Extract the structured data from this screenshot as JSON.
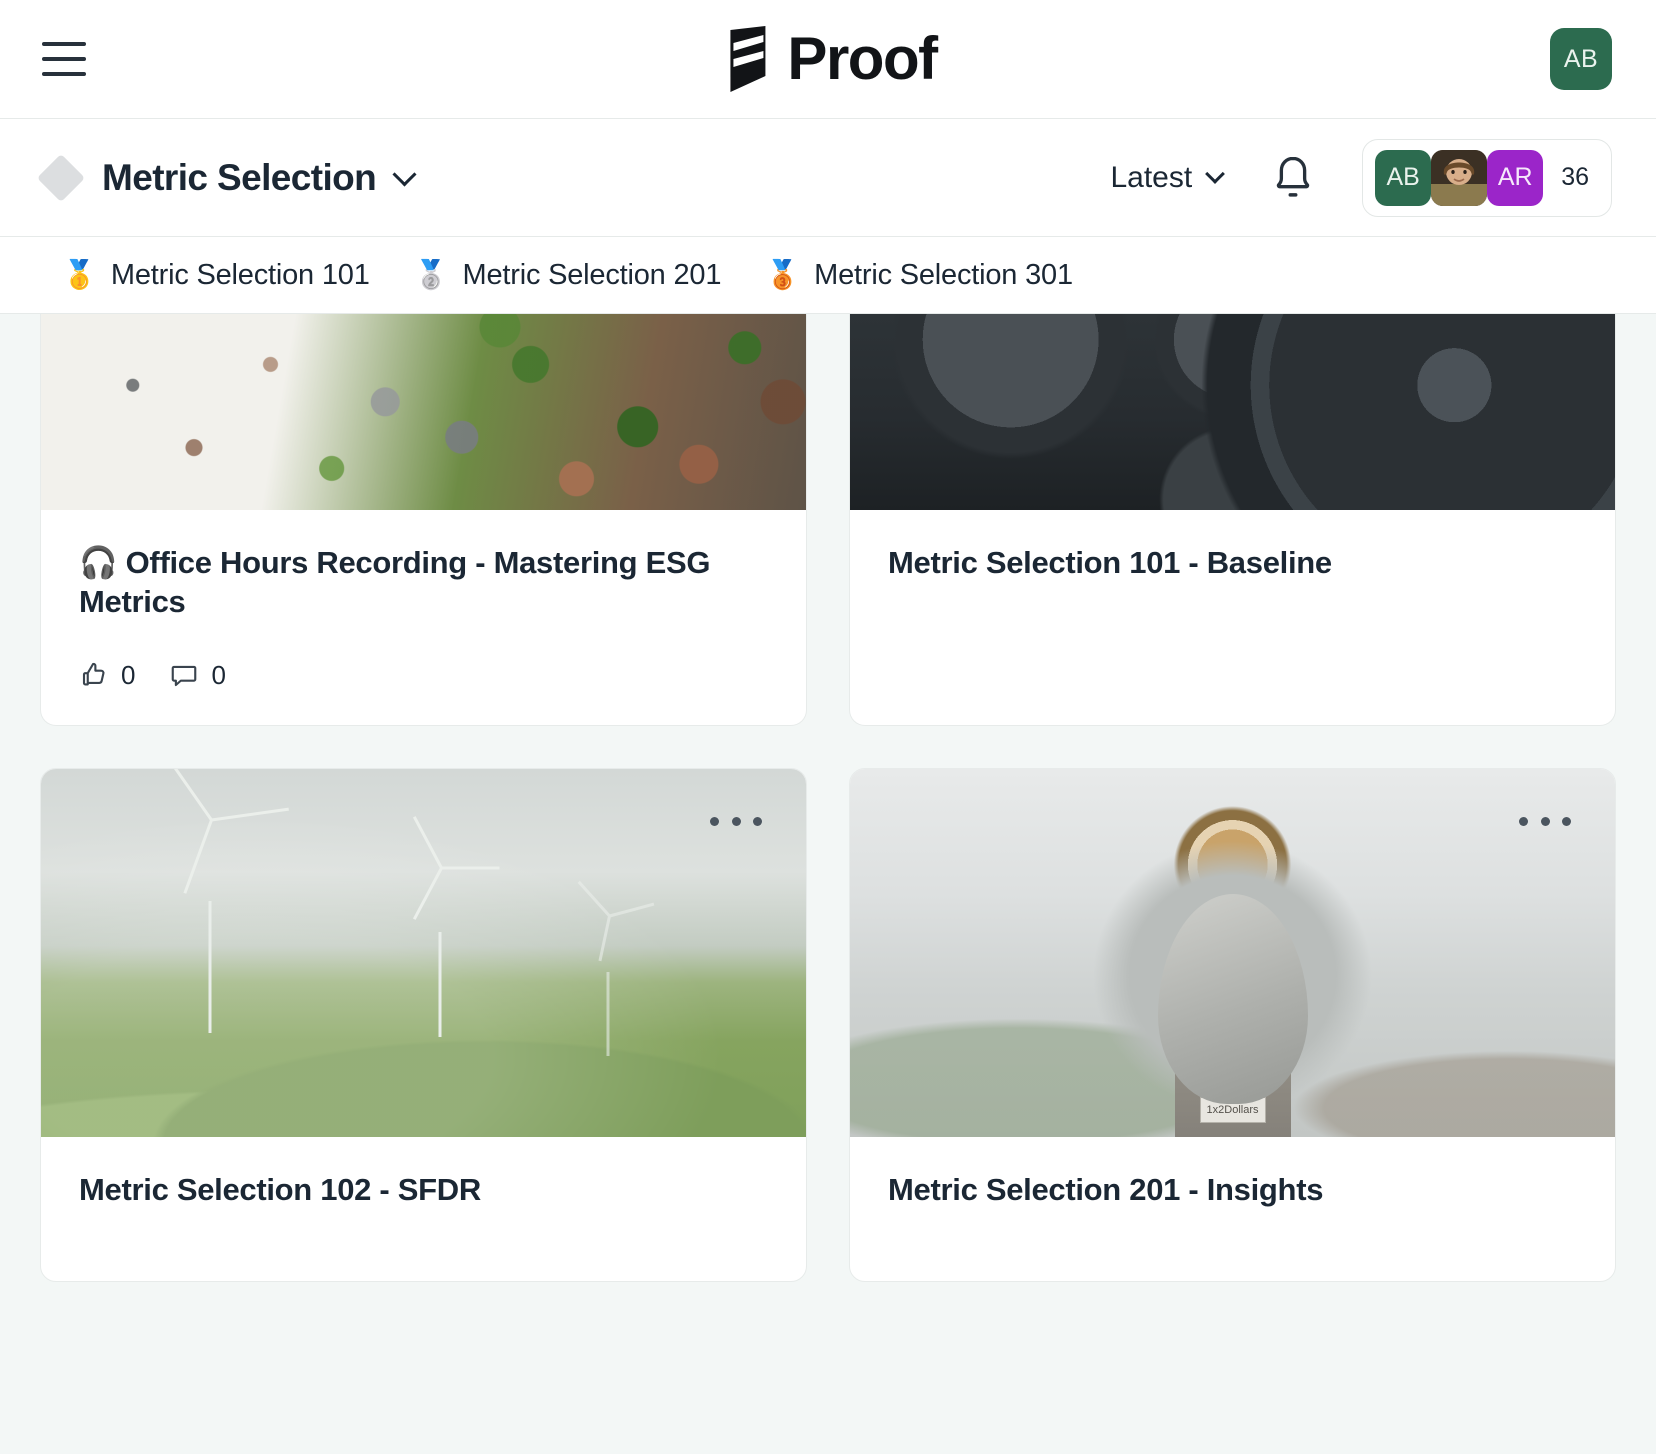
{
  "topbar": {
    "menu_icon": "hamburger-icon",
    "brand_name": "Proof",
    "brand_mark_icon": "proof-logo-mark",
    "user_initials": "AB",
    "user_avatar_color": "#2C6B4F"
  },
  "subheader": {
    "space_icon": "diamond-icon",
    "title": "Metric Selection",
    "title_chevron_icon": "chevron-down-icon",
    "sort": {
      "label": "Latest",
      "chevron_icon": "chevron-down-icon"
    },
    "notifications_icon": "bell-icon",
    "members": {
      "avatars": [
        {
          "type": "initials",
          "initials": "AB",
          "color": "#2C6B4F"
        },
        {
          "type": "photo",
          "initials": "",
          "color": "#6B5A44"
        },
        {
          "type": "initials",
          "initials": "AR",
          "color": "#9B25C9"
        }
      ],
      "count": "36"
    }
  },
  "tabs": [
    {
      "emoji": "🥇",
      "label": "Metric Selection 101",
      "icon": "gold-medal-icon"
    },
    {
      "emoji": "🥈",
      "label": "Metric Selection 201",
      "icon": "silver-medal-icon"
    },
    {
      "emoji": "🥉",
      "label": "Metric Selection 301",
      "icon": "bronze-medal-icon"
    }
  ],
  "cards": [
    {
      "title": "🎧 Office Hours Recording - Mastering ESG Metrics",
      "image": "rocks-and-moss-photo",
      "has_more_menu": false,
      "likes": "0",
      "comments": "0",
      "like_icon": "thumbs-up-icon",
      "comment_icon": "comment-icon"
    },
    {
      "title": "Metric Selection 101 - Baseline",
      "image": "engine-gauges-photo",
      "has_more_menu": false,
      "likes": "",
      "comments": "",
      "like_icon": "thumbs-up-icon",
      "comment_icon": "comment-icon"
    },
    {
      "title": "Metric Selection 102 - SFDR",
      "image": "wind-turbines-photo",
      "has_more_menu": true,
      "more_icon": "more-horizontal-icon",
      "likes": "",
      "comments": "",
      "like_icon": "thumbs-up-icon",
      "comment_icon": "comment-icon"
    },
    {
      "title": "Metric Selection 201 - Insights",
      "image": "coin-telescope-photo",
      "has_more_menu": true,
      "more_icon": "more-horizontal-icon",
      "likes": "",
      "comments": "",
      "like_icon": "thumbs-up-icon",
      "comment_icon": "comment-icon"
    }
  ],
  "telescope_plate_text": "1x2Dollars"
}
